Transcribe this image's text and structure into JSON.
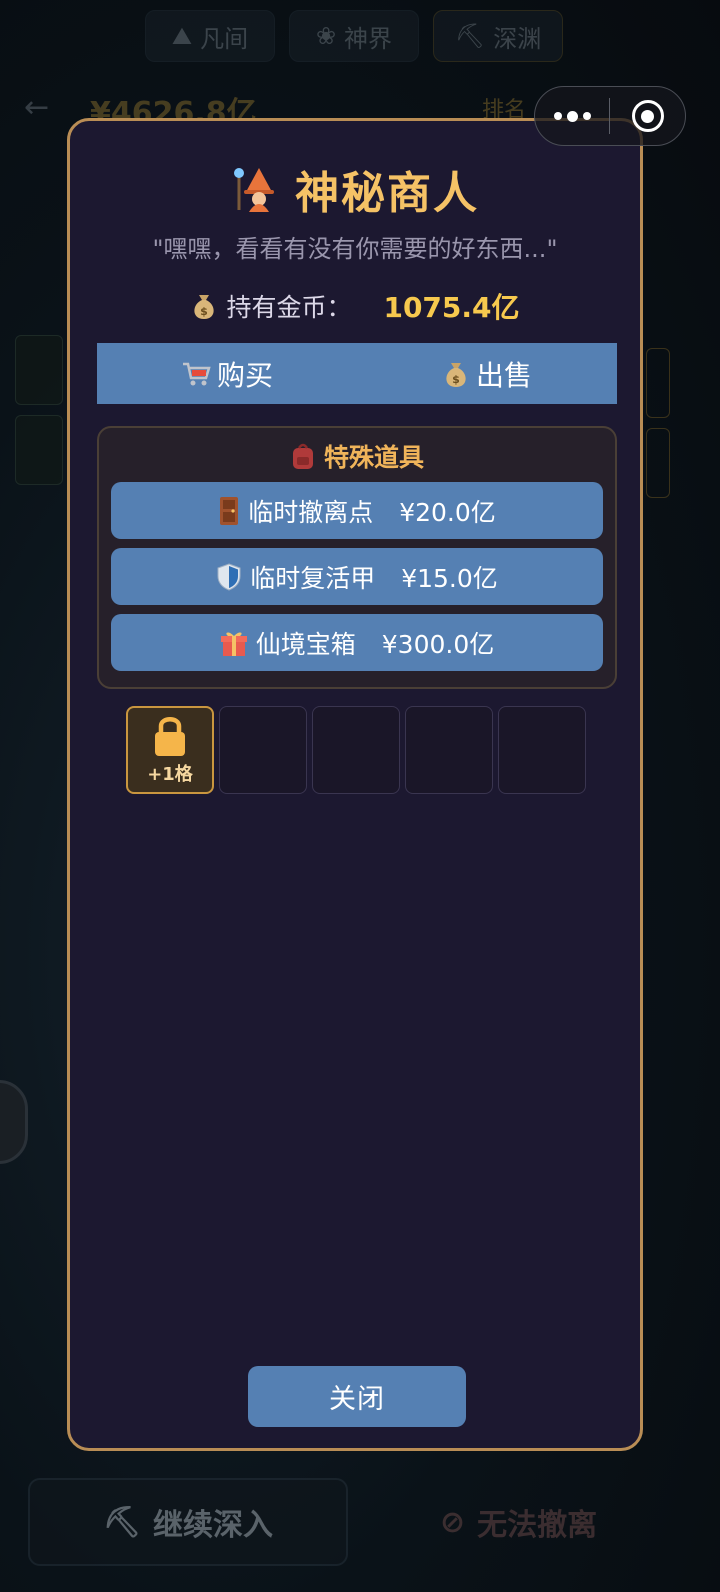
{
  "background": {
    "tabs": [
      {
        "icon": "mountain-icon",
        "label": "凡间"
      },
      {
        "icon": "lotus-icon",
        "label": "神界"
      },
      {
        "icon": "pickaxe-icon",
        "label": "深渊"
      }
    ],
    "money": "¥4626.8亿",
    "rank_label": "排名",
    "bottom_left_label": "继续深入",
    "bottom_right_label": "无法撤离"
  },
  "merchant": {
    "icon": "wizard-icon",
    "title": "神秘商人",
    "subtitle": "\"嘿嘿，看看有没有你需要的好东西...\"",
    "coins_label": "持有金币：",
    "coins_value": "1075.4亿",
    "tabs": [
      {
        "icon": "cart-icon",
        "label": "购买"
      },
      {
        "icon": "money-bag-icon",
        "label": "出售"
      }
    ],
    "special_section": {
      "icon": "backpack-icon",
      "title": "特殊道具",
      "items": [
        {
          "icon": "door-icon",
          "name": "临时撤离点",
          "price": "¥20.0亿"
        },
        {
          "icon": "shield-icon",
          "name": "临时复活甲",
          "price": "¥15.0亿"
        },
        {
          "icon": "gift-icon",
          "name": "仙境宝箱",
          "price": "¥300.0亿"
        }
      ]
    },
    "inventory": {
      "locked_slot_label": "+1格",
      "empty_slots": 4
    },
    "close_label": "关闭"
  },
  "colors": {
    "modal_bg": "#1c1830",
    "modal_border": "#b98d55",
    "button_blue": "#5580b3",
    "title_gold": "#f5c266",
    "coin_gold": "#f7c94e"
  }
}
